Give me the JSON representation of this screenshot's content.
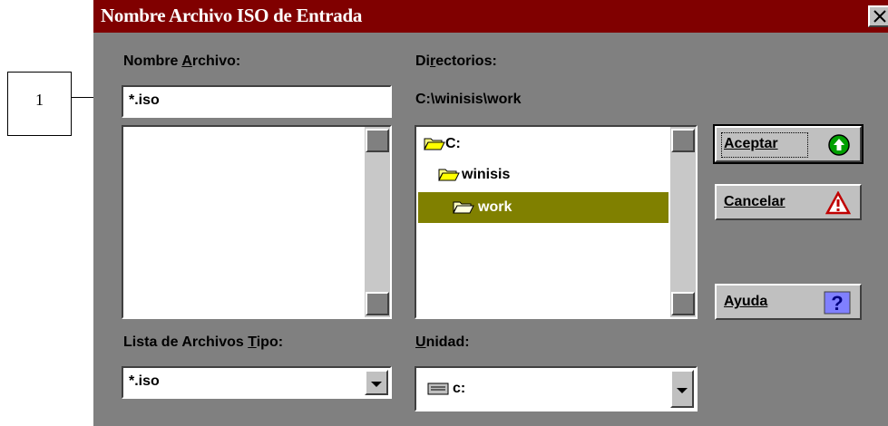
{
  "annotation": {
    "number": "1"
  },
  "dialog": {
    "title": "Nombre Archivo ISO de Entrada",
    "filename": {
      "label_pre": "Nombre ",
      "label_key": "A",
      "label_post": "rchivo:",
      "value": "*.iso"
    },
    "directories": {
      "label_pre": "Di",
      "label_key": "r",
      "label_post": "ectorios:",
      "path": "C:\\winisis\\work",
      "items": [
        {
          "name": "C:",
          "icon": "open-folder-icon"
        },
        {
          "name": "winisis",
          "icon": "open-folder-icon"
        },
        {
          "name": "work",
          "icon": "open-folder-icon",
          "selected": true
        }
      ]
    },
    "file_type": {
      "label_pre": "Lista de Archivos ",
      "label_key": "T",
      "label_post": "ipo:",
      "value": "*.iso"
    },
    "drive": {
      "label_pre": "",
      "label_key": "U",
      "label_post": "nidad:",
      "value": "c:",
      "icon": "drive-icon"
    },
    "buttons": {
      "accept": {
        "label": "Aceptar",
        "icon": "green-up-arrow-icon"
      },
      "cancel": {
        "label": "Cancelar",
        "icon": "warning-triangle-icon"
      },
      "help": {
        "label": "Ayuda",
        "icon": "question-mark-icon"
      }
    }
  },
  "colors": {
    "titlebar": "#800000",
    "dialog_bg": "#808080",
    "selection": "#808000"
  }
}
